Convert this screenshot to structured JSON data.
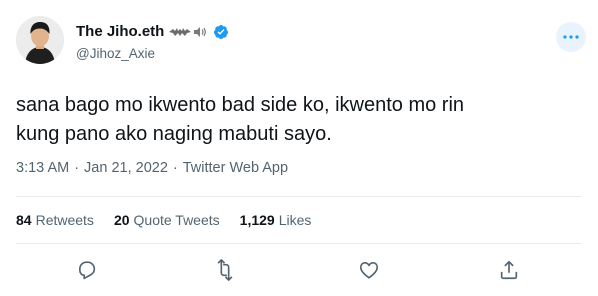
{
  "author": {
    "display_name": "The Jiho.eth",
    "handle": "@Jihoz_Axie",
    "verified": true
  },
  "tweet": {
    "lines": [
      "sana bago mo ikwento bad side ko, ikwento mo rin",
      "kung pano ako naging mabuti sayo."
    ]
  },
  "meta": {
    "time": "3:13 AM",
    "date": "Jan 21, 2022",
    "source": "Twitter Web App"
  },
  "stats": {
    "retweets": {
      "count": "84",
      "label": "Retweets"
    },
    "quote_tweets": {
      "count": "20",
      "label": "Quote Tweets"
    },
    "likes": {
      "count": "1,129",
      "label": "Likes"
    }
  },
  "colors": {
    "accent": "#1d9bf0",
    "text": "#0f1419",
    "muted": "#536471"
  },
  "icons": [
    "more-icon",
    "verified-icon",
    "reply-icon",
    "retweet-icon",
    "like-icon",
    "share-icon"
  ]
}
